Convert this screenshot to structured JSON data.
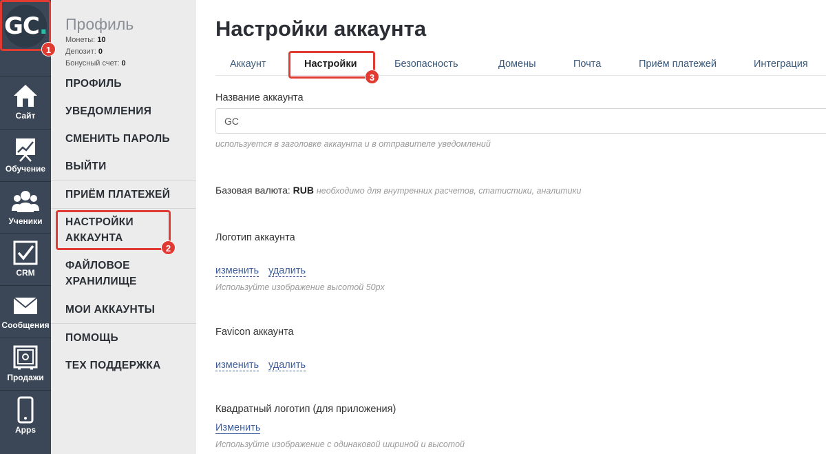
{
  "rail": {
    "logo_text": "GC",
    "logo_dot": ".",
    "items": [
      {
        "label": "Сайт",
        "icon": "house-icon"
      },
      {
        "label": "Обучение",
        "icon": "presentation-chart-icon"
      },
      {
        "label": "Ученики",
        "icon": "users-icon"
      },
      {
        "label": "CRM",
        "icon": "checkbox-icon"
      },
      {
        "label": "Сообщения",
        "icon": "envelope-icon"
      },
      {
        "label": "Продажи",
        "icon": "safe-icon"
      },
      {
        "label": "Apps",
        "icon": "phone-icon"
      }
    ]
  },
  "sidebar": {
    "title": "Профиль",
    "coins_label": "Монеты:",
    "coins_value": "10",
    "deposit_label": "Депозит:",
    "deposit_value": "0",
    "bonus_label": "Бонусный счет:",
    "bonus_value": "0",
    "menu": [
      "ПРОФИЛЬ",
      "УВЕДОМЛЕНИЯ",
      "СМЕНИТЬ ПАРОЛЬ",
      "ВЫЙТИ",
      "ПРИЁМ ПЛАТЕЖЕЙ",
      "НАСТРОЙКИ АККАУНТА",
      "ФАЙЛОВОЕ ХРАНИЛИЩЕ",
      "МОИ АККАУНТЫ",
      "ПОМОЩЬ",
      "ТЕХ ПОДДЕРЖКА"
    ]
  },
  "main": {
    "title": "Настройки аккаунта",
    "tabs": [
      "Аккаунт",
      "Настройки",
      "Безопасность",
      "Домены",
      "Почта",
      "Приём платежей",
      "Интеграция"
    ],
    "active_tab": "Настройки",
    "account_name_label": "Название аккаунта",
    "account_name_value": "GC",
    "account_name_hint": "используется в заголовке аккаунта и в отправителе уведомлений",
    "base_currency_label": "Базовая валюта:",
    "base_currency_value": "RUB",
    "base_currency_hint": "необходимо для внутренних расчетов, статистики, аналитики",
    "logo_label": "Логотип аккаунта",
    "logo_change": "изменить",
    "logo_delete": "удалить",
    "logo_hint": "Используйте изображение высотой 50px",
    "favicon_label": "Favicon аккаунта",
    "favicon_change": "изменить",
    "favicon_delete": "удалить",
    "square_logo_label": "Квадратный логотип (для приложения)",
    "square_logo_change": "Изменить",
    "square_logo_hint": "Используйте изображение с одинаковой шириной и высотой"
  },
  "annotations": {
    "badge_1": "1",
    "badge_2": "2",
    "badge_3": "3",
    "color": "#e03a33"
  }
}
